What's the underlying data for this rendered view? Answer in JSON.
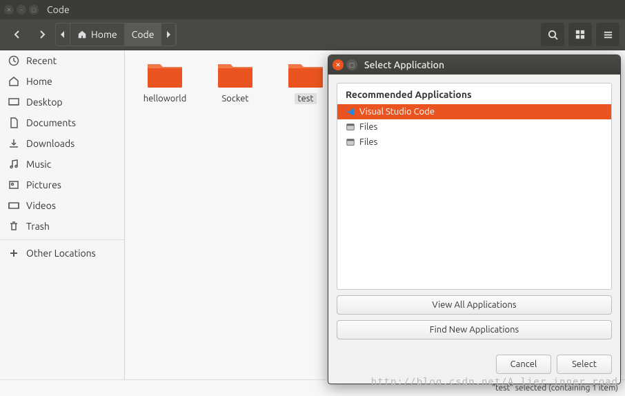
{
  "window": {
    "title": "Code"
  },
  "toolbar": {
    "path": {
      "home": "Home",
      "current": "Code"
    }
  },
  "sidebar": {
    "items": [
      {
        "icon": "clock-icon",
        "label": "Recent"
      },
      {
        "icon": "home-icon",
        "label": "Home"
      },
      {
        "icon": "desktop-icon",
        "label": "Desktop"
      },
      {
        "icon": "document-icon",
        "label": "Documents"
      },
      {
        "icon": "download-icon",
        "label": "Downloads"
      },
      {
        "icon": "music-icon",
        "label": "Music"
      },
      {
        "icon": "pictures-icon",
        "label": "Pictures"
      },
      {
        "icon": "videos-icon",
        "label": "Videos"
      },
      {
        "icon": "trash-icon",
        "label": "Trash"
      }
    ],
    "other": {
      "icon": "plus-icon",
      "label": "Other Locations"
    }
  },
  "content": {
    "folders": [
      {
        "name": "helloworld",
        "selected": false
      },
      {
        "name": "Socket",
        "selected": false
      },
      {
        "name": "test",
        "selected": true
      }
    ]
  },
  "statusbar": {
    "text": "\"test\" selected  (containing 1 item)"
  },
  "dialog": {
    "title": "Select Application",
    "recommended_header": "Recommended Applications",
    "apps": [
      {
        "name": "Visual Studio Code",
        "icon": "vscode-icon",
        "selected": true
      },
      {
        "name": "Files",
        "icon": "files-icon",
        "selected": false
      },
      {
        "name": "Files",
        "icon": "files-icon",
        "selected": false
      }
    ],
    "view_all": "View All Applications",
    "find_new": "Find New Applications",
    "cancel": "Cancel",
    "select": "Select"
  },
  "watermark": "http://blog.csdn.net/A_lier_inner_road"
}
